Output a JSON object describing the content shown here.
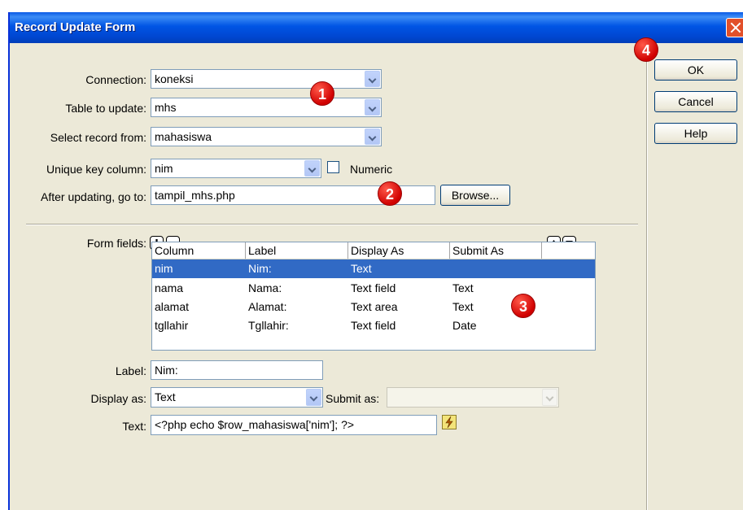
{
  "window": {
    "title": "Record Update Form"
  },
  "fields": {
    "connection_label": "Connection:",
    "connection_value": "koneksi",
    "table_label": "Table to update:",
    "table_value": "mhs",
    "select_record_label": "Select record from:",
    "select_record_value": "mahasiswa",
    "unique_key_label": "Unique key column:",
    "unique_key_value": "nim",
    "numeric_label": "Numeric",
    "numeric_checked": false,
    "after_update_label": "After updating, go to:",
    "after_update_value": "tampil_mhs.php",
    "browse_label": "Browse..."
  },
  "form_fields": {
    "label": "Form fields:",
    "columns": [
      "Column",
      "Label",
      "Display As",
      "Submit As"
    ],
    "rows": [
      {
        "column": "nim",
        "label": "Nim:",
        "display_as": "Text",
        "submit_as": ""
      },
      {
        "column": "nama",
        "label": "Nama:",
        "display_as": "Text field",
        "submit_as": "Text"
      },
      {
        "column": "alamat",
        "label": "Alamat:",
        "display_as": "Text area",
        "submit_as": "Text"
      },
      {
        "column": "tgllahir",
        "label": "Tgllahir:",
        "display_as": "Text field",
        "submit_as": "Date"
      }
    ],
    "selected_row": 0
  },
  "detail": {
    "label_label": "Label:",
    "label_value": "Nim:",
    "display_as_label": "Display as:",
    "display_as_value": "Text",
    "submit_as_label": "Submit as:",
    "submit_as_value": "",
    "text_label": "Text:",
    "text_value": "<?php echo $row_mahasiswa['nim']; ?>"
  },
  "buttons": {
    "ok": "OK",
    "cancel": "Cancel",
    "help": "Help"
  },
  "markers": [
    "1",
    "2",
    "3",
    "4"
  ],
  "icons": [
    "close-icon",
    "chevron-down-icon",
    "plus-icon",
    "minus-icon",
    "arrow-up-icon",
    "arrow-down-icon",
    "lightning-icon"
  ],
  "colors": {
    "title_bar": "#0055e5",
    "selection": "#316ac5",
    "marker_red": "#d00000",
    "dialog_bg": "#ece9d8"
  }
}
